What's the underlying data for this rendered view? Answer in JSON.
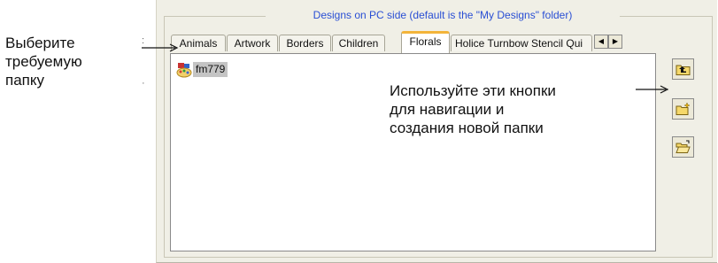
{
  "group_title": "Designs on PC side (default is the \"My Designs\" folder)",
  "tabs": [
    {
      "label": "Animals",
      "active": false
    },
    {
      "label": "Artwork",
      "active": false
    },
    {
      "label": "Borders",
      "active": false
    },
    {
      "label": "Children",
      "active": false
    },
    {
      "label": "Florals",
      "active": true
    },
    {
      "label": "Holice Turnbow Stencil Qui",
      "active": false
    }
  ],
  "tab_scroll": {
    "left_glyph": "◀",
    "right_glyph": "▶"
  },
  "list": {
    "items": [
      {
        "label": "fm779",
        "icon": "design-palette-icon",
        "selected": true
      }
    ]
  },
  "side_buttons": [
    {
      "name": "up-folder-button",
      "icon": "up-folder-icon"
    },
    {
      "name": "new-folder-button",
      "icon": "new-folder-icon"
    },
    {
      "name": "open-folder-button",
      "icon": "open-folder-icon"
    }
  ],
  "annotations": {
    "left_text": "Выберите\nтребуемую\nпапку",
    "right_text": "Используйте эти кнопки\nдля навигации и\nсоздания новой папки"
  },
  "colors": {
    "panel_bg": "#f0efe6",
    "group_title": "#2a4fd4",
    "active_tab_accent": "#f3b43a",
    "selection_bg": "#c4c4c4"
  }
}
